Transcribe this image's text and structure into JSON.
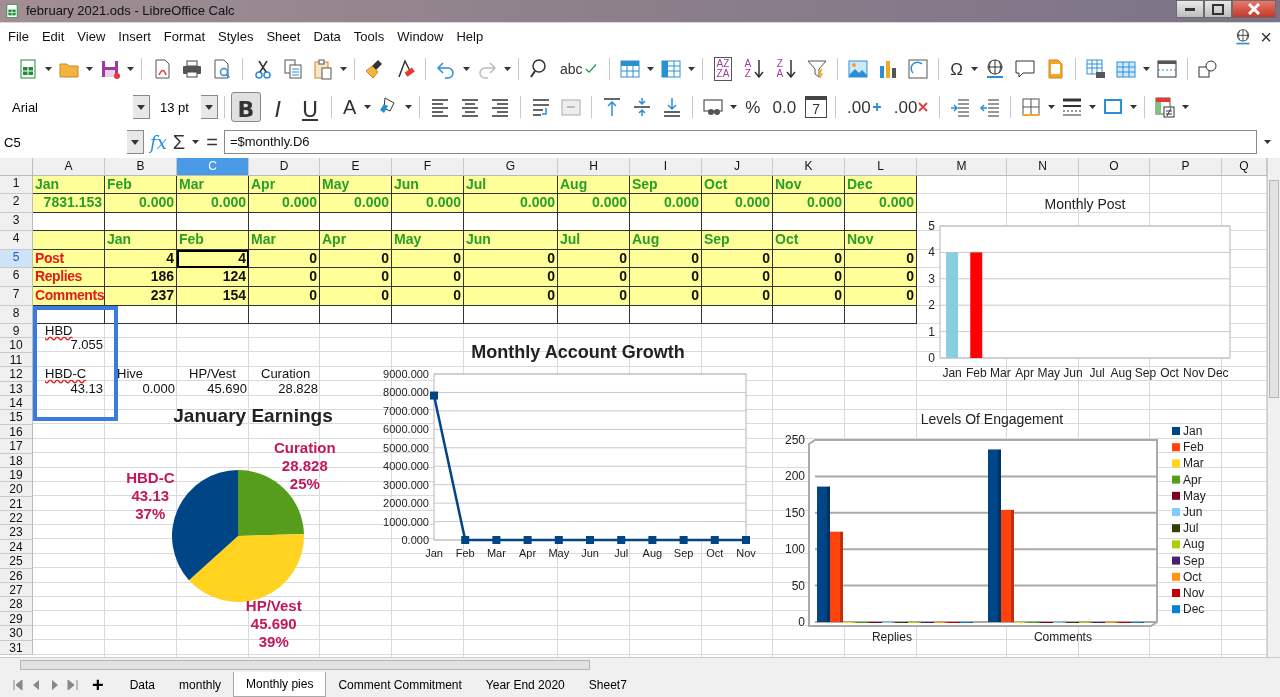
{
  "window": {
    "title": "february 2021.ods - LibreOffice Calc"
  },
  "menu": [
    "File",
    "Edit",
    "View",
    "Insert",
    "Format",
    "Styles",
    "Sheet",
    "Data",
    "Tools",
    "Window",
    "Help"
  ],
  "menu_close": "×",
  "toolbar_text": {
    "spell": "abc",
    "sort_box": [
      "AZ",
      "ZA"
    ],
    "sort_asc": "AZ",
    "sort_desc": "ZA",
    "omega": "Ω"
  },
  "formatting": {
    "font": "Arial",
    "size": "13 pt",
    "toggles": [
      {
        "label": "B",
        "selected": true
      },
      {
        "label": "I",
        "selected": false
      },
      {
        "label": "U",
        "selected": false
      }
    ],
    "font_color": "A",
    "percent": "%",
    "number": "0.0",
    "date": "7",
    "add_decimal": ".00",
    "delete_decimal": ".00"
  },
  "formula_bar": {
    "cell": "C5",
    "function": "fx",
    "sum": "Σ",
    "equals": "=",
    "value": "=$monthly.D6"
  },
  "sheet": {
    "columns": [
      {
        "label": "A",
        "selected": false
      },
      {
        "label": "B",
        "selected": false
      },
      {
        "label": "C",
        "selected": true
      },
      {
        "label": "D",
        "selected": false
      },
      {
        "label": "E",
        "selected": false
      },
      {
        "label": "F",
        "selected": false
      },
      {
        "label": "G",
        "selected": false
      },
      {
        "label": "H",
        "selected": false
      },
      {
        "label": "I",
        "selected": false
      },
      {
        "label": "J",
        "selected": false
      },
      {
        "label": "K",
        "selected": false
      },
      {
        "label": "L",
        "selected": false
      },
      {
        "label": "M",
        "selected": false
      },
      {
        "label": "N",
        "selected": false
      },
      {
        "label": "O",
        "selected": false
      },
      {
        "label": "P",
        "selected": false
      },
      {
        "label": "Q",
        "selected": false
      }
    ],
    "rows": [
      {
        "label": "1",
        "selected": false
      },
      {
        "label": "2",
        "selected": false
      },
      {
        "label": "3",
        "selected": false
      },
      {
        "label": "4",
        "selected": false
      },
      {
        "label": "5",
        "selected": true
      },
      {
        "label": "6",
        "selected": false
      },
      {
        "label": "7",
        "selected": false
      },
      {
        "label": "8",
        "selected": false
      },
      {
        "label": "9",
        "selected": false
      },
      {
        "label": "10",
        "selected": false
      },
      {
        "label": "11",
        "selected": false
      },
      {
        "label": "12",
        "selected": false
      },
      {
        "label": "13",
        "selected": false
      },
      {
        "label": "14",
        "selected": false
      },
      {
        "label": "15",
        "selected": false
      },
      {
        "label": "16",
        "selected": false
      },
      {
        "label": "17",
        "selected": false
      },
      {
        "label": "18",
        "selected": false
      },
      {
        "label": "19",
        "selected": false
      },
      {
        "label": "20",
        "selected": false
      },
      {
        "label": "21",
        "selected": false
      },
      {
        "label": "22",
        "selected": false
      },
      {
        "label": "23",
        "selected": false
      },
      {
        "label": "24",
        "selected": false
      },
      {
        "label": "25",
        "selected": false
      },
      {
        "label": "26",
        "selected": false
      },
      {
        "label": "27",
        "selected": false
      },
      {
        "label": "28",
        "selected": false
      },
      {
        "label": "29",
        "selected": false
      },
      {
        "label": "30",
        "selected": false
      },
      {
        "label": "31",
        "selected": false
      }
    ]
  },
  "grid": [
    {
      "kind": "months",
      "cells": [
        "Jan",
        "Feb",
        "Mar",
        "Apr",
        "May",
        "Jun",
        "Jul",
        "Aug",
        "Sep",
        "Oct",
        "Nov",
        "Dec"
      ]
    },
    {
      "kind": "totals",
      "cells": [
        "7831.153",
        "0.000",
        "0.000",
        "0.000",
        "0.000",
        "0.000",
        "0.000",
        "0.000",
        "0.000",
        "0.000",
        "0.000",
        "0.000"
      ]
    },
    {
      "kind": "blank"
    },
    {
      "kind": "months",
      "cells": [
        null,
        "Jan",
        "Feb",
        "Mar",
        "Apr",
        "May",
        "Jun",
        "Jul",
        "Aug",
        "Sep",
        "Oct",
        "Nov"
      ]
    },
    {
      "kind": "counts",
      "label": "Post",
      "cells": [
        "4",
        "4",
        "0",
        "0",
        "0",
        "0",
        "0",
        "0",
        "0",
        "0",
        "0"
      ]
    },
    {
      "kind": "counts",
      "label": "Replies",
      "cells": [
        "186",
        "124",
        "0",
        "0",
        "0",
        "0",
        "0",
        "0",
        "0",
        "0",
        "0"
      ]
    },
    {
      "kind": "counts",
      "label": "Comments",
      "cells": [
        "237",
        "154",
        "0",
        "0",
        "0",
        "0",
        "0",
        "0",
        "0",
        "0",
        "0"
      ]
    },
    {
      "kind": "blank"
    }
  ],
  "notes": [
    {
      "kind": "label",
      "cells": [
        {
          "text": "HBD",
          "misspelled": true
        }
      ]
    },
    {
      "kind": "number",
      "cells": [
        {
          "text": "7.055",
          "misspelled": false
        }
      ]
    },
    {
      "kind": "blank"
    },
    {
      "kind": "label",
      "cells": [
        {
          "text": "HBD-C",
          "misspelled": true
        },
        {
          "text": "Hive",
          "misspelled": false
        },
        {
          "text": "HP/Vest",
          "misspelled": false
        },
        {
          "text": "Curation",
          "misspelled": false
        }
      ]
    },
    {
      "kind": "number",
      "cells": [
        {
          "text": "43.13",
          "misspelled": false
        },
        {
          "text": "0.000",
          "misspelled": false
        },
        {
          "text": "45.690",
          "misspelled": false
        },
        {
          "text": "28.828",
          "misspelled": false
        }
      ]
    }
  ],
  "charts": [
    {
      "chart_data": {
        "type": "bar",
        "title": "Monthly Post",
        "grid": true,
        "categories": [
          "Jan",
          "Feb",
          "Mar",
          "Apr",
          "May",
          "Jun",
          "Jul",
          "Aug",
          "Sep",
          "Oct",
          "Nov",
          "Dec"
        ],
        "series": [
          {
            "color": "#87cee0",
            "values": [
              4,
              null,
              null,
              null,
              null,
              null,
              null,
              null,
              null,
              null,
              null,
              null
            ]
          },
          {
            "color": "#ff0000",
            "values": [
              null,
              4,
              null,
              null,
              null,
              null,
              null,
              null,
              null,
              null,
              null,
              null
            ]
          }
        ],
        "ylim": [
          0,
          5
        ],
        "yticks": [
          {
            "value": 0,
            "label": "0"
          },
          {
            "value": 1,
            "label": "1"
          },
          {
            "value": 2,
            "label": "2"
          },
          {
            "value": 3,
            "label": "3"
          },
          {
            "value": 4,
            "label": "4"
          },
          {
            "value": 5,
            "label": "5"
          }
        ]
      }
    },
    {
      "chart_data": {
        "type": "line",
        "title": "Monthly Account Growth",
        "categories": [
          "Jan",
          "Feb",
          "Mar",
          "Apr",
          "May",
          "Jun",
          "Jul",
          "Aug",
          "Sep",
          "Oct",
          "Nov"
        ],
        "series": [
          {
            "color": "#004586",
            "marker": "square",
            "values": [
              7831.153,
              0,
              0,
              0,
              0,
              0,
              0,
              0,
              0,
              0,
              0
            ]
          }
        ],
        "grid": true,
        "ylim": [
          0,
          9000
        ],
        "yticks": [
          {
            "value": 0,
            "label": "0.000"
          },
          {
            "value": 1000,
            "label": "1000.000"
          },
          {
            "value": 2000,
            "label": "2000.000"
          },
          {
            "value": 3000,
            "label": "3000.000"
          },
          {
            "value": 4000,
            "label": "4000.000"
          },
          {
            "value": 5000,
            "label": "5000.000"
          },
          {
            "value": 6000,
            "label": "6000.000"
          },
          {
            "value": 7000,
            "label": "7000.000"
          },
          {
            "value": 8000,
            "label": "8000.000"
          },
          {
            "value": 9000,
            "label": "9000.000"
          }
        ]
      }
    },
    {
      "chart_data": {
        "type": "pie",
        "title": "January Earnings",
        "categories": [
          "Curation",
          "HP/Vest",
          "HBD-C"
        ],
        "colors": [
          "#579d1c",
          "#ffd320",
          "#004586"
        ],
        "values": [
          28.828,
          45.69,
          43.13
        ],
        "value_labels": [
          "28.828",
          "45.690",
          "43.13"
        ],
        "annotations": [
          {
            "x": "Curation",
            "text": "25%"
          },
          {
            "x": "HP/Vest",
            "text": "39%"
          },
          {
            "x": "HBD-C",
            "text": "37%"
          }
        ]
      }
    },
    {
      "chart_data": {
        "type": "bar",
        "title": "Levels Of Engagement",
        "grid": true,
        "legend": "right",
        "categories": [
          "Replies",
          "Comments"
        ],
        "ylim": [
          0,
          250
        ],
        "yticks": [
          {
            "value": 0,
            "label": "0"
          },
          {
            "value": 50,
            "label": "50"
          },
          {
            "value": 100,
            "label": "100"
          },
          {
            "value": 150,
            "label": "150"
          },
          {
            "value": 200,
            "label": "200"
          },
          {
            "value": 250,
            "label": "250"
          }
        ],
        "series": [
          {
            "name": "Jan",
            "color": "#004586",
            "values": [
              186,
              237
            ]
          },
          {
            "name": "Feb",
            "color": "#ff420e",
            "values": [
              124,
              154
            ]
          },
          {
            "name": "Mar",
            "color": "#ffd320",
            "values": [
              0,
              0
            ]
          },
          {
            "name": "Apr",
            "color": "#579d1c",
            "values": [
              0,
              0
            ]
          },
          {
            "name": "May",
            "color": "#7e0021",
            "values": [
              0,
              0
            ]
          },
          {
            "name": "Jun",
            "color": "#83caff",
            "values": [
              0,
              0
            ]
          },
          {
            "name": "Jul",
            "color": "#314004",
            "values": [
              0,
              0
            ]
          },
          {
            "name": "Aug",
            "color": "#aecf00",
            "values": [
              0,
              0
            ]
          },
          {
            "name": "Sep",
            "color": "#4b1f6f",
            "values": [
              0,
              0
            ]
          },
          {
            "name": "Oct",
            "color": "#ff950e",
            "values": [
              0,
              0
            ]
          },
          {
            "name": "Nov",
            "color": "#c5000b",
            "values": [
              0,
              0
            ]
          },
          {
            "name": "Dec",
            "color": "#0084d1",
            "values": [
              0,
              0
            ]
          }
        ]
      }
    }
  ],
  "sheet_tabs": {
    "add": "+",
    "tabs": [
      {
        "label": "Data",
        "selected": false
      },
      {
        "label": "monthly",
        "selected": false
      },
      {
        "label": "Monthly pies",
        "selected": true
      },
      {
        "label": "Comment Commitment",
        "selected": false
      },
      {
        "label": "Year End 2020",
        "selected": false
      },
      {
        "label": "Sheet7",
        "selected": false
      }
    ]
  }
}
